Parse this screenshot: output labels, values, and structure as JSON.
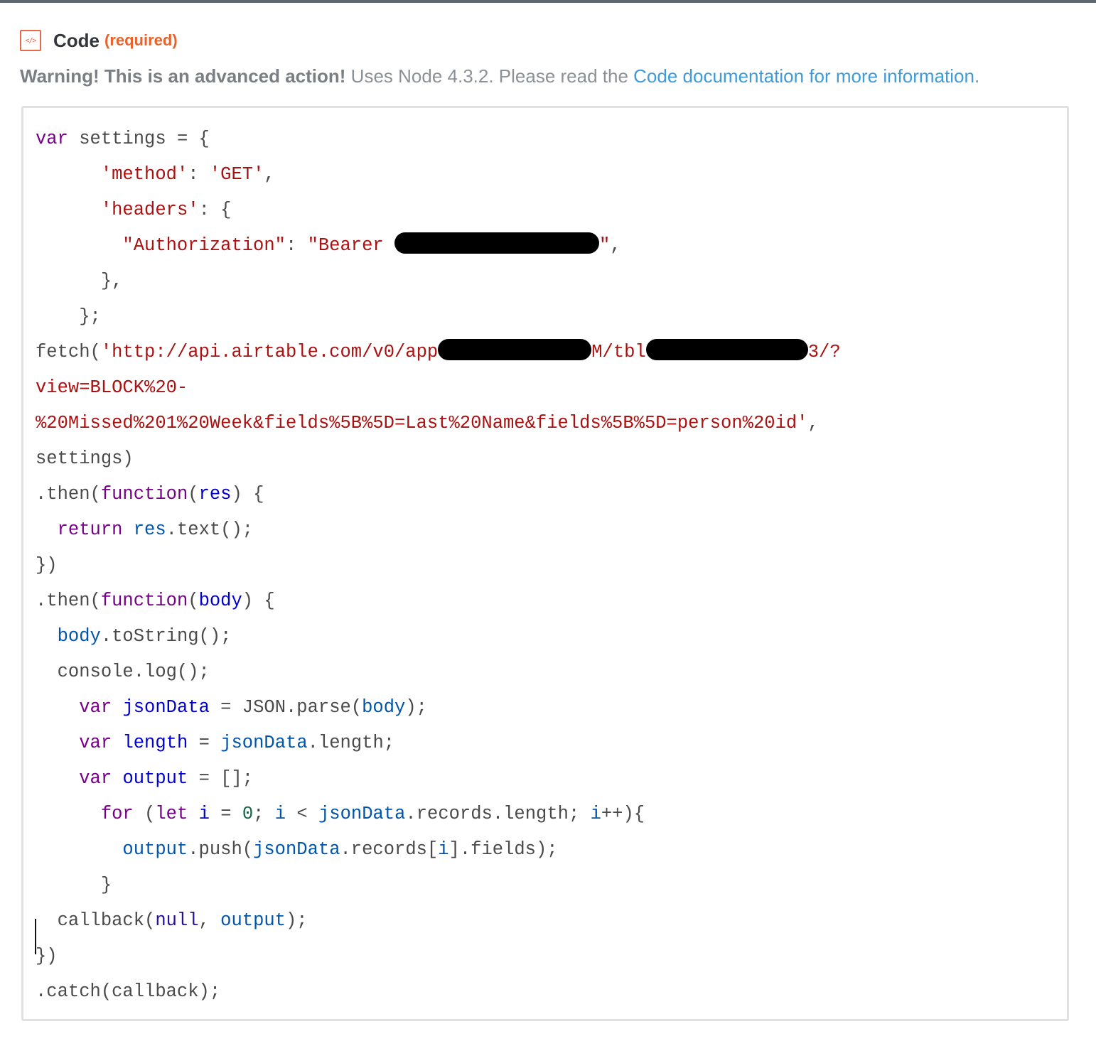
{
  "field": {
    "icon": "code-brackets-icon",
    "icon_glyph": "</>",
    "title": "Code",
    "required_label": "(required)"
  },
  "warning": {
    "bold": "Warning! This is an advanced action!",
    "text": " Uses Node 4.3.2. Please read the ",
    "link": "Code documentation for more information."
  },
  "editor": {
    "code": [
      "var settings = {",
      "      'method': 'GET',",
      "      'headers': {",
      "        \"Authorization\": \"Bearer [redacted]\",",
      "      },",
      "    };",
      "fetch('http://api.airtable.com/v0/app[redacted]M/tbl[redacted]3/?",
      "view=BLOCK%20-",
      "%20Missed%201%20Week&fields%5B%5D=Last%20Name&fields%5B%5D=person%20id',",
      "settings)",
      ".then(function(res) {",
      "  return res.text();",
      "})",
      ".then(function(body) {",
      "  body.toString();",
      "  console.log();",
      "    var jsonData = JSON.parse(body);",
      "    var length = jsonData.length;",
      "    var output = [];",
      "      for (let i = 0; i < jsonData.records.length; i++){",
      "        output.push(jsonData.records[i].fields);",
      "      }",
      "  callback(null, output);",
      "})",
      ".catch(callback);"
    ]
  },
  "colors": {
    "accent": "#e8684a",
    "link": "#3f9ad8",
    "keyword": "#770088",
    "string": "#aa1111",
    "variable": "#0055aa"
  }
}
